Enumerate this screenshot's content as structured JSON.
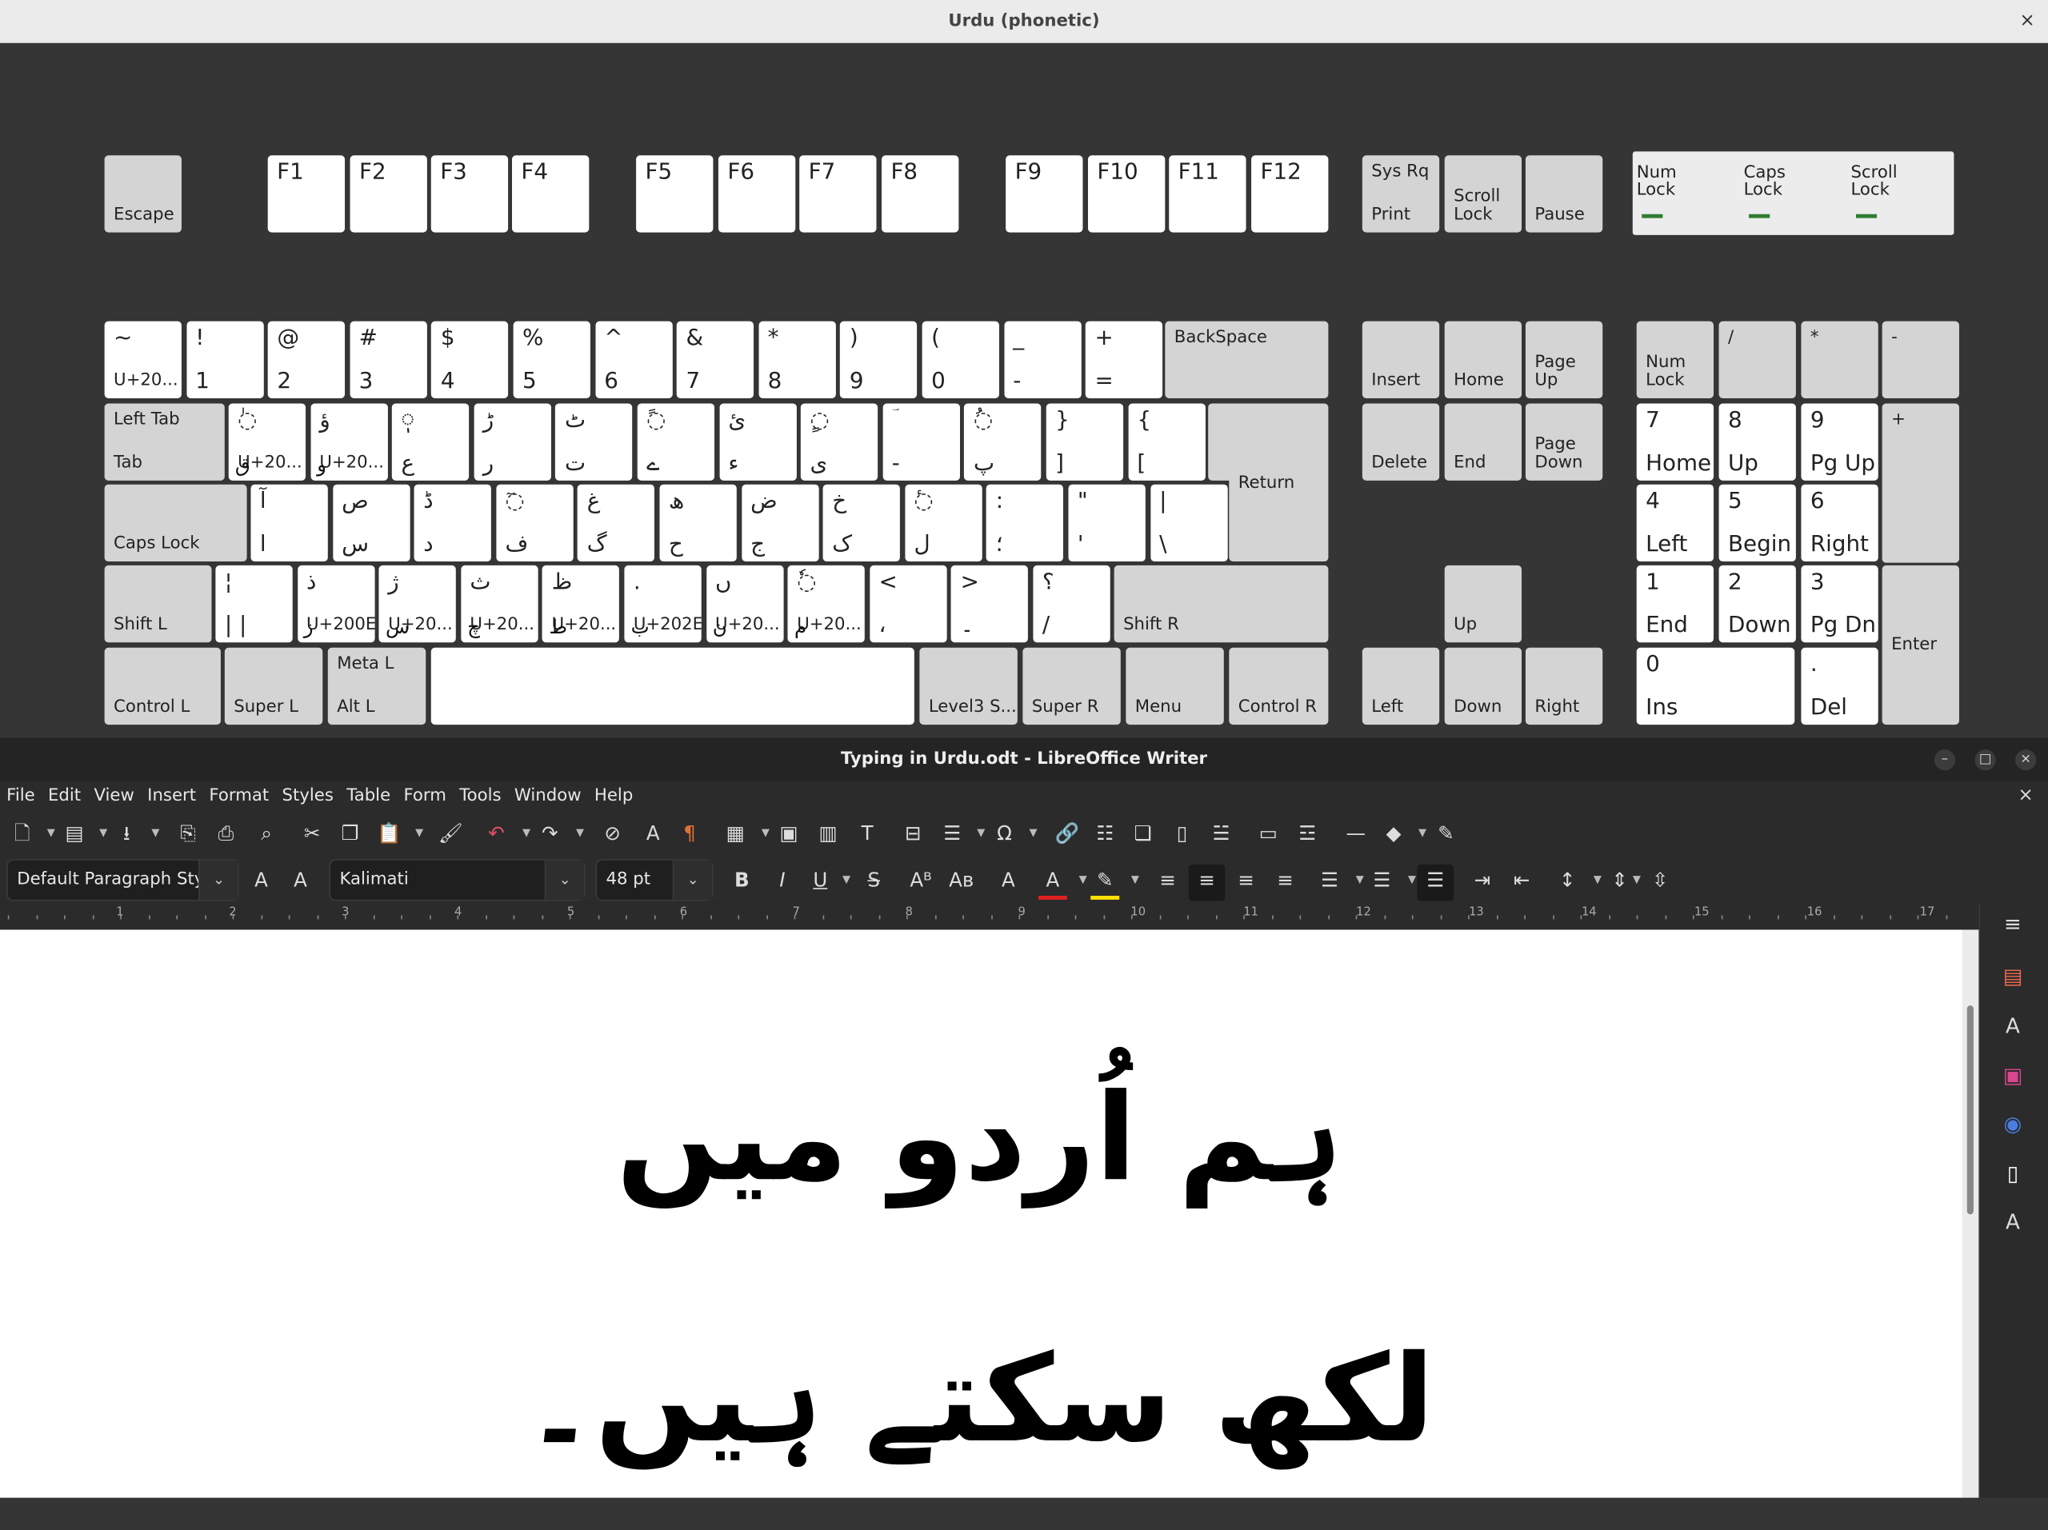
{
  "keyboard_window": {
    "title": "Urdu (phonetic)",
    "close": "×",
    "fn_row": [
      {
        "b": "Escape"
      },
      {
        "t": "F1"
      },
      {
        "t": "F2"
      },
      {
        "t": "F3"
      },
      {
        "t": "F4"
      },
      {
        "t": "F5"
      },
      {
        "t": "F6"
      },
      {
        "t": "F7"
      },
      {
        "t": "F8"
      },
      {
        "t": "F9"
      },
      {
        "t": "F10"
      },
      {
        "t": "F11"
      },
      {
        "t": "F12"
      },
      {
        "t": "Sys Rq",
        "b": "Print"
      },
      {
        "b": "Scroll\nLock"
      },
      {
        "b": "Pause"
      }
    ],
    "indicators": [
      {
        "label": "Num\nLock",
        "on": true
      },
      {
        "label": "Caps\nLock",
        "on": true
      },
      {
        "label": "Scroll\nLock",
        "on": true
      }
    ],
    "row1": [
      {
        "t": "~",
        "b": "U+20..."
      },
      {
        "t": "!",
        "b": "1"
      },
      {
        "t": "@",
        "b": "2"
      },
      {
        "t": "#",
        "b": "3"
      },
      {
        "t": "$",
        "b": "4"
      },
      {
        "t": "%",
        "b": "5"
      },
      {
        "t": "^",
        "b": "6"
      },
      {
        "t": "&",
        "b": "7"
      },
      {
        "t": "*",
        "b": "8"
      },
      {
        "t": ")",
        "b": "9"
      },
      {
        "t": "(",
        "b": "0"
      },
      {
        "t": "_",
        "b": "-"
      },
      {
        "t": "+",
        "b": "="
      },
      {
        "t": "BackSpace"
      }
    ],
    "row2": [
      {
        "t": "Left Tab",
        "b": "Tab"
      },
      {
        "t": "◌ٰ",
        "b": "U+20...",
        "u": "ق"
      },
      {
        "t": "ؤ",
        "b": "U+20...",
        "u": "و"
      },
      {
        "t": "◌ٖ",
        "b": "ع"
      },
      {
        "t": "ڑ",
        "b": "ر"
      },
      {
        "t": "ٹ",
        "b": "ت"
      },
      {
        "t": "◌ً",
        "b": "ے"
      },
      {
        "t": "ئ",
        "b": "ء"
      },
      {
        "t": "◌ٍ",
        "b": "ی"
      },
      {
        "t": "ؔ",
        "b": "-"
      },
      {
        "t": "◌ُ",
        "b": "پ"
      },
      {
        "t": "}",
        "b": "]"
      },
      {
        "t": "{",
        "b": "["
      },
      {
        "m": "Return"
      }
    ],
    "row3": [
      {
        "b": "Caps Lock"
      },
      {
        "t": "آ",
        "b": "ا"
      },
      {
        "t": "ص",
        "b": "س"
      },
      {
        "t": "ڈ",
        "b": "د"
      },
      {
        "t": "◌ٓ",
        "b": "ف"
      },
      {
        "t": "غ",
        "b": "گ"
      },
      {
        "t": "ھ",
        "b": "ح"
      },
      {
        "t": "ض",
        "b": "ج"
      },
      {
        "t": "خ",
        "b": "ک"
      },
      {
        "t": "◌ٔ",
        "b": "ل"
      },
      {
        "t": ":",
        "b": "؛"
      },
      {
        "t": "\"",
        "b": "'"
      },
      {
        "t": "|",
        "b": "\\"
      }
    ],
    "row4": [
      {
        "b": "Shift L"
      },
      {
        "t": "¦",
        "b": "|    |"
      },
      {
        "t": "ذ",
        "b": "U+200E",
        "u": "ز"
      },
      {
        "t": "ژ",
        "b": "U+20...",
        "u": "س"
      },
      {
        "t": "ث",
        "b": "U+20...",
        "u": "چ"
      },
      {
        "t": "ظ",
        "b": "U+20...",
        "u": "ط"
      },
      {
        "t": ".",
        "b": "U+202E",
        "u": "ب"
      },
      {
        "t": "ں",
        "b": "U+20...",
        "u": "ن"
      },
      {
        "t": "◌ٗ",
        "b": "U+20...",
        "u": "م"
      },
      {
        "t": "<",
        "b": "،"
      },
      {
        "t": ">",
        "b": "۔"
      },
      {
        "t": "؟",
        "b": "/"
      },
      {
        "b": "Shift R"
      }
    ],
    "row5": [
      {
        "b": "Control L"
      },
      {
        "b": "Super L"
      },
      {
        "t": "Meta L",
        "b": "Alt L"
      },
      {},
      {
        "b": "Level3 S..."
      },
      {
        "b": "Super R"
      },
      {
        "b": "Menu"
      },
      {
        "b": "Control R"
      }
    ],
    "nav": [
      {
        "b": "Insert"
      },
      {
        "b": "Home"
      },
      {
        "b": "Page\nUp"
      },
      {
        "b": "Delete"
      },
      {
        "b": "End"
      },
      {
        "b": "Page\nDown"
      },
      {
        "b": "Up"
      },
      {
        "b": "Left"
      },
      {
        "b": "Down"
      },
      {
        "b": "Right"
      }
    ],
    "numpad": [
      {
        "b": "Num\nLock"
      },
      {
        "t": "/"
      },
      {
        "t": "*"
      },
      {
        "t": "-"
      },
      {
        "t": "7",
        "b": "Home"
      },
      {
        "t": "8",
        "b": "Up"
      },
      {
        "t": "9",
        "b": "Pg Up"
      },
      {
        "t": "+"
      },
      {
        "t": "4",
        "b": "Left"
      },
      {
        "t": "5",
        "b": "Begin"
      },
      {
        "t": "6",
        "b": "Right"
      },
      {
        "t": "1",
        "b": "End"
      },
      {
        "t": "2",
        "b": "Down"
      },
      {
        "t": "3",
        "b": "Pg Dn"
      },
      {
        "m": "Enter"
      },
      {
        "t": "0",
        "b": "Ins"
      },
      {
        "t": ".",
        "b": "Del"
      }
    ]
  },
  "writer": {
    "title": "Typing in Urdu.odt - LibreOffice Writer",
    "window_controls": [
      "–",
      "□",
      "×"
    ],
    "close_doc": "×",
    "menu": [
      "File",
      "Edit",
      "View",
      "Insert",
      "Format",
      "Styles",
      "Table",
      "Form",
      "Tools",
      "Window",
      "Help"
    ],
    "toolbar1": [
      {
        "icon": "new-document-icon",
        "g": "🗋"
      },
      {
        "icon": "open-icon",
        "g": "▤"
      },
      {
        "icon": "save-icon",
        "g": "⭳"
      },
      {
        "icon": "export-pdf-icon",
        "g": "⎘"
      },
      {
        "icon": "print-icon",
        "g": "⎙"
      },
      {
        "icon": "print-preview-icon",
        "g": "⌕"
      },
      {
        "icon": "cut-icon",
        "g": "✂"
      },
      {
        "icon": "copy-icon",
        "g": "❐"
      },
      {
        "icon": "paste-icon",
        "g": "📋"
      },
      {
        "icon": "clone-formatting-icon",
        "g": "🖌"
      },
      {
        "icon": "undo-icon",
        "g": "↶"
      },
      {
        "icon": "redo-icon",
        "g": "↷"
      },
      {
        "icon": "find-replace-icon",
        "g": "⊘"
      },
      {
        "icon": "spelling-icon",
        "g": "A"
      },
      {
        "icon": "formatting-marks-icon",
        "g": "¶"
      },
      {
        "icon": "insert-table-icon",
        "g": "▦"
      },
      {
        "icon": "insert-image-icon",
        "g": "▣"
      },
      {
        "icon": "insert-chart-icon",
        "g": "▥"
      },
      {
        "icon": "insert-textbox-icon",
        "g": "T"
      },
      {
        "icon": "page-break-icon",
        "g": "⊟"
      },
      {
        "icon": "insert-field-icon",
        "g": "☰"
      },
      {
        "icon": "special-character-icon",
        "g": "Ω"
      },
      {
        "icon": "hyperlink-icon",
        "g": "🔗"
      },
      {
        "icon": "footnote-icon",
        "g": "☷"
      },
      {
        "icon": "endnote-icon",
        "g": "❏"
      },
      {
        "icon": "bookmark-icon",
        "g": "▯"
      },
      {
        "icon": "cross-reference-icon",
        "g": "☱"
      },
      {
        "icon": "comment-icon",
        "g": "▭"
      },
      {
        "icon": "track-changes-icon",
        "g": "☲"
      },
      {
        "icon": "line-icon",
        "g": "—"
      },
      {
        "icon": "basic-shapes-icon",
        "g": "◆"
      },
      {
        "icon": "draw-icon",
        "g": "✎"
      }
    ],
    "paragraph_style": "Default Paragraph Styl",
    "font_name": "Kalimati",
    "font_size": "48 pt",
    "toolbar2": [
      {
        "icon": "update-style-icon",
        "g": "A"
      },
      {
        "icon": "new-style-icon",
        "g": "A"
      },
      {
        "icon": "bold-icon",
        "g": "B"
      },
      {
        "icon": "italic-icon",
        "g": "I"
      },
      {
        "icon": "underline-icon",
        "g": "U"
      },
      {
        "icon": "strikethrough-icon",
        "g": "S"
      },
      {
        "icon": "superscript-icon",
        "g": "Aᴮ"
      },
      {
        "icon": "subscript-icon",
        "g": "Aʙ"
      },
      {
        "icon": "clear-formatting-icon",
        "g": "A"
      },
      {
        "icon": "font-color-icon",
        "g": "A"
      },
      {
        "icon": "highlight-icon",
        "g": "✎"
      },
      {
        "icon": "align-left-icon",
        "g": "≡"
      },
      {
        "icon": "align-center-icon",
        "g": "≡"
      },
      {
        "icon": "align-right-icon",
        "g": "≡"
      },
      {
        "icon": "justify-icon",
        "g": "≡"
      },
      {
        "icon": "unordered-list-icon",
        "g": "☰"
      },
      {
        "icon": "ordered-list-icon",
        "g": "☰"
      },
      {
        "icon": "outline-list-icon",
        "g": "☰"
      },
      {
        "icon": "increase-indent-icon",
        "g": "⇥"
      },
      {
        "icon": "decrease-indent-icon",
        "g": "⇤"
      },
      {
        "icon": "line-spacing-icon",
        "g": "↕"
      },
      {
        "icon": "paragraph-spacing-increase-icon",
        "g": "⇕"
      },
      {
        "icon": "paragraph-spacing-decrease-icon",
        "g": "⇳"
      }
    ],
    "ruler_labels": [
      "1",
      "2",
      "3",
      "4",
      "5",
      "6",
      "7",
      "8",
      "9",
      "10",
      "11",
      "12",
      "13",
      "14",
      "15",
      "16",
      "17"
    ],
    "document_text": "ہم اُردو میں لکھ سکتے ہیں۔",
    "sidebar": [
      {
        "icon": "sidebar-menu-icon",
        "g": "≡",
        "c": "#ddd"
      },
      {
        "icon": "properties-icon",
        "g": "▤",
        "c": "#f26b4f"
      },
      {
        "icon": "styles-icon",
        "g": "A",
        "c": "#ddd"
      },
      {
        "icon": "gallery-icon",
        "g": "▣",
        "c": "#d9468f"
      },
      {
        "icon": "navigator-icon",
        "g": "◉",
        "c": "#4a7ee0"
      },
      {
        "icon": "page-icon",
        "g": "▯",
        "c": "#fff"
      },
      {
        "icon": "style-inspector-icon",
        "g": "A",
        "c": "#ddd"
      }
    ],
    "colors": {
      "font_color": "#e02020",
      "highlight": "#ffe000",
      "active_button": "#1a1a1a"
    }
  }
}
